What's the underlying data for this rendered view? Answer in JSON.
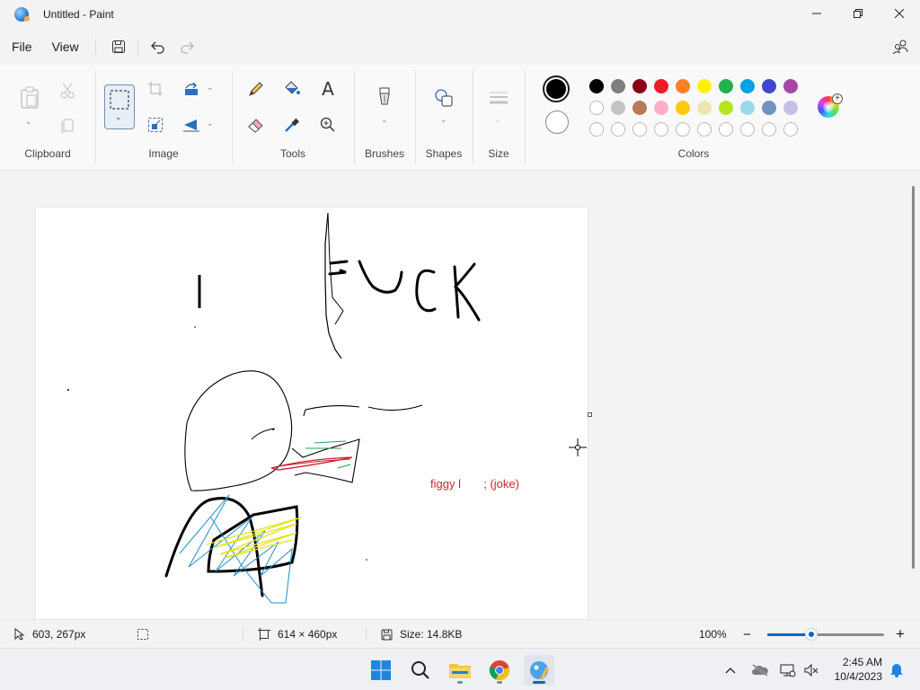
{
  "window": {
    "title": "Untitled - Paint",
    "controls": {
      "minimize": "─",
      "maximize": "▢",
      "close": "✕"
    }
  },
  "menu": {
    "file": "File",
    "view": "View"
  },
  "ribbon": {
    "groups": {
      "clipboard": "Clipboard",
      "image": "Image",
      "tools": "Tools",
      "brushes": "Brushes",
      "shapes": "Shapes",
      "size": "Size",
      "colors": "Colors"
    },
    "text_tool_glyph": "A"
  },
  "colors": {
    "primary": "#000000",
    "secondary": "#ffffff",
    "palette_row1": [
      "#000000",
      "#7f7f7f",
      "#880015",
      "#ed1c24",
      "#ff7f27",
      "#fff200",
      "#22b14c",
      "#00a2e8",
      "#3f48cc",
      "#a349a4"
    ],
    "palette_row2": [
      "#ffffff",
      "#c3c3c3",
      "#b97a57",
      "#ffaec9",
      "#ffc90e",
      "#efe4b0",
      "#b5e61d",
      "#99d9ea",
      "#7092be",
      "#c8bfe7"
    ],
    "palette_row3_empty_count": 10,
    "accent": "#0067c0"
  },
  "canvas": {
    "text_word": "FUCK",
    "text_letter_i": "I",
    "caption": "figgy l       ; (joke)",
    "caption_color": "#d1242f"
  },
  "status": {
    "cursor_position": "603, 267px",
    "canvas_size": "614 × 460px",
    "file_size": "Size: 14.8KB",
    "zoom": "100%",
    "zoom_minus": "−",
    "zoom_plus": "+",
    "zoom_fraction": 0.38
  },
  "taskbar": {
    "time": "2:45 AM",
    "date": "10/4/2023",
    "apps": [
      "start-icon",
      "search-icon",
      "file-explorer-icon",
      "chrome-icon",
      "paint-icon"
    ],
    "active_app": "paint-icon"
  }
}
